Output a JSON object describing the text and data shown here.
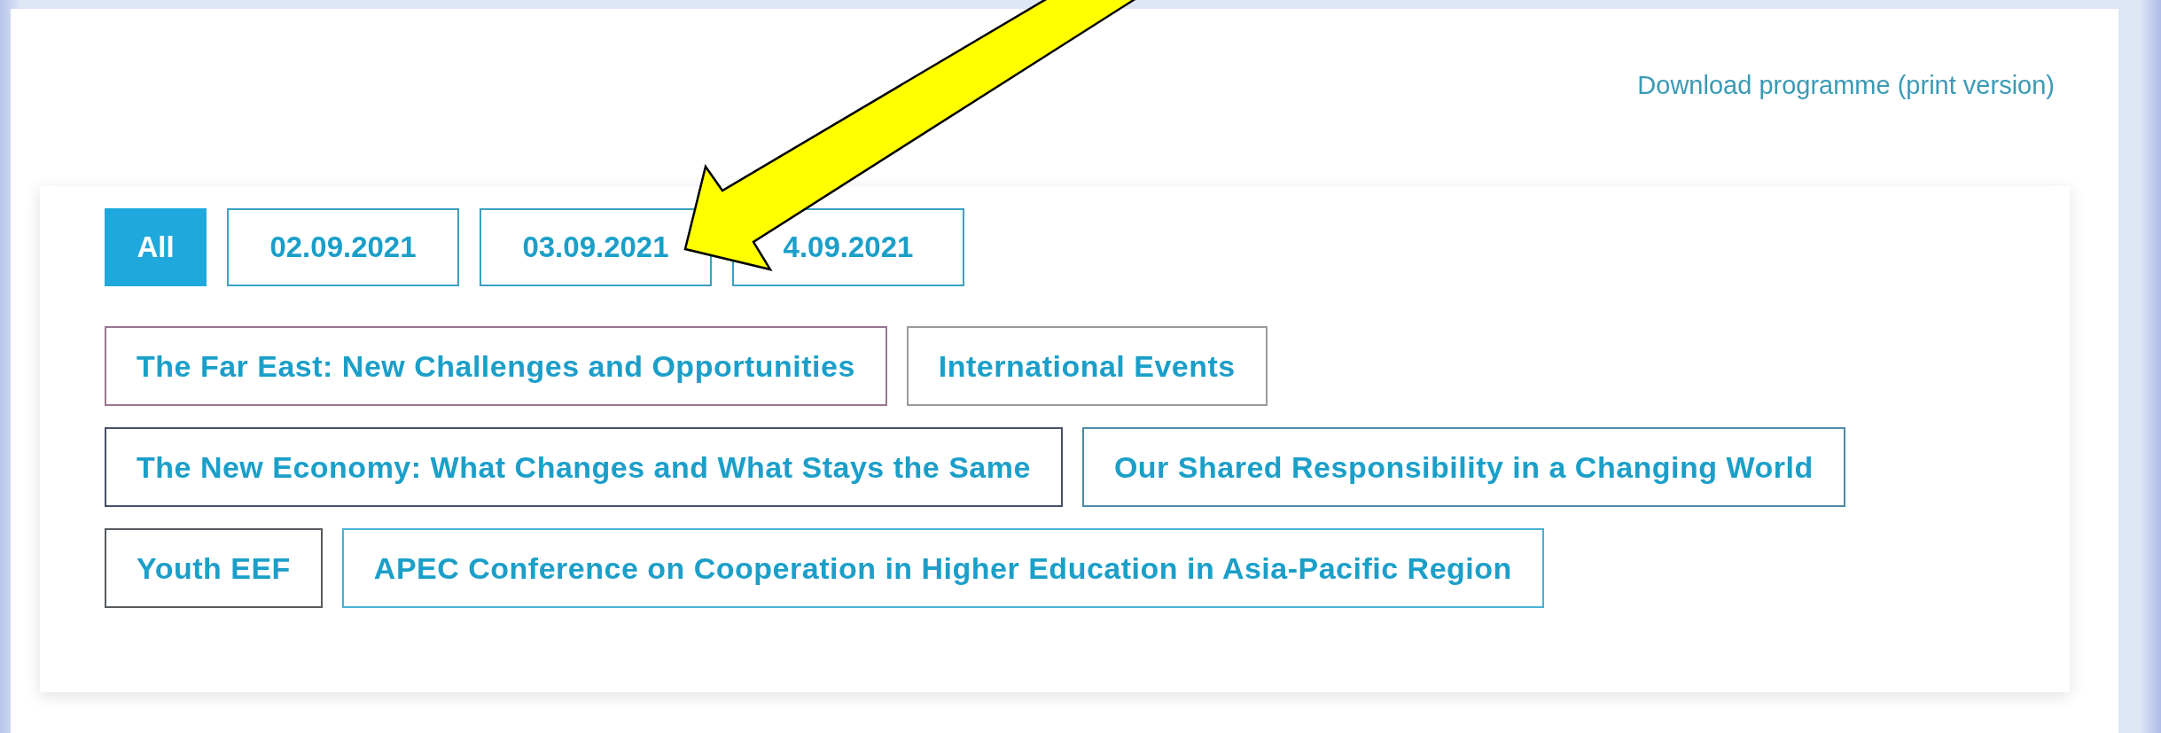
{
  "download_link": "Download programme (print version)",
  "date_tabs": [
    {
      "label": "All",
      "selected": true
    },
    {
      "label": "02.09.2021",
      "selected": false
    },
    {
      "label": "03.09.2021",
      "selected": false
    },
    {
      "label": "4.09.2021",
      "selected": false
    }
  ],
  "topic_rows": [
    [
      {
        "label": "The Far East: New Challenges and Opportunities",
        "color": "#9a7590"
      },
      {
        "label": "International Events",
        "color": "#9a9a9a"
      }
    ],
    [
      {
        "label": "The New Economy: What Changes and What Stays the Same",
        "color": "#4a4f66"
      },
      {
        "label": "Our Shared Responsibility in a Changing World",
        "color": "#4a8aa3"
      }
    ],
    [
      {
        "label": "Youth EEF",
        "color": "#555a5e"
      },
      {
        "label": "APEC Conference on Cooperation in Higher Education in Asia-Pacific Region",
        "color": "#45b3d6"
      }
    ]
  ]
}
